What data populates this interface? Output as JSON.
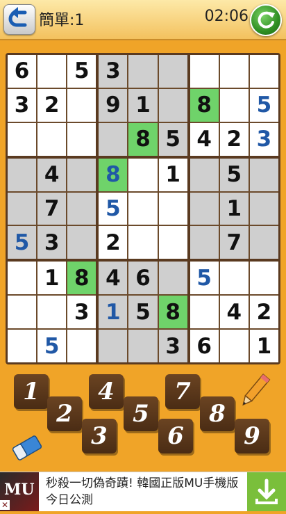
{
  "header": {
    "level_label": "簡單:1",
    "timer": "02:06",
    "back_icon": "back-arrow-icon",
    "confirm_icon": "refresh-check-icon"
  },
  "colors": {
    "background": "#f0a428",
    "cell_light": "#ffffff",
    "cell_dark": "#cfcfcf",
    "cell_highlight": "#6fd36a",
    "user_digit": "#2058a6",
    "key_brown": "#5a3a1a"
  },
  "grid": [
    [
      {
        "v": "6",
        "s": ""
      },
      {
        "v": "",
        "s": ""
      },
      {
        "v": "5",
        "s": ""
      },
      {
        "v": "3",
        "s": ""
      },
      {
        "v": "",
        "s": ""
      },
      {
        "v": "",
        "s": ""
      },
      {
        "v": "",
        "s": ""
      },
      {
        "v": "",
        "s": ""
      },
      {
        "v": "",
        "s": ""
      }
    ],
    [
      {
        "v": "3",
        "s": ""
      },
      {
        "v": "2",
        "s": ""
      },
      {
        "v": "",
        "s": ""
      },
      {
        "v": "9",
        "s": ""
      },
      {
        "v": "1",
        "s": ""
      },
      {
        "v": "",
        "s": ""
      },
      {
        "v": "8",
        "s": "green"
      },
      {
        "v": "",
        "s": ""
      },
      {
        "v": "5",
        "s": "blue"
      }
    ],
    [
      {
        "v": "",
        "s": ""
      },
      {
        "v": "",
        "s": ""
      },
      {
        "v": "",
        "s": ""
      },
      {
        "v": "",
        "s": ""
      },
      {
        "v": "8",
        "s": "green"
      },
      {
        "v": "5",
        "s": ""
      },
      {
        "v": "4",
        "s": ""
      },
      {
        "v": "2",
        "s": ""
      },
      {
        "v": "3",
        "s": "blue"
      }
    ],
    [
      {
        "v": "",
        "s": ""
      },
      {
        "v": "4",
        "s": ""
      },
      {
        "v": "",
        "s": ""
      },
      {
        "v": "8",
        "s": "green blue"
      },
      {
        "v": "",
        "s": ""
      },
      {
        "v": "1",
        "s": ""
      },
      {
        "v": "",
        "s": ""
      },
      {
        "v": "5",
        "s": ""
      },
      {
        "v": "",
        "s": ""
      }
    ],
    [
      {
        "v": "",
        "s": ""
      },
      {
        "v": "7",
        "s": ""
      },
      {
        "v": "",
        "s": ""
      },
      {
        "v": "5",
        "s": "blue"
      },
      {
        "v": "",
        "s": ""
      },
      {
        "v": "",
        "s": ""
      },
      {
        "v": "",
        "s": ""
      },
      {
        "v": "1",
        "s": ""
      },
      {
        "v": "",
        "s": ""
      }
    ],
    [
      {
        "v": "5",
        "s": "blue"
      },
      {
        "v": "3",
        "s": ""
      },
      {
        "v": "",
        "s": ""
      },
      {
        "v": "2",
        "s": ""
      },
      {
        "v": "",
        "s": ""
      },
      {
        "v": "",
        "s": ""
      },
      {
        "v": "",
        "s": ""
      },
      {
        "v": "7",
        "s": ""
      },
      {
        "v": "",
        "s": ""
      }
    ],
    [
      {
        "v": "",
        "s": ""
      },
      {
        "v": "1",
        "s": ""
      },
      {
        "v": "8",
        "s": "green"
      },
      {
        "v": "4",
        "s": ""
      },
      {
        "v": "6",
        "s": ""
      },
      {
        "v": "",
        "s": ""
      },
      {
        "v": "5",
        "s": "blue"
      },
      {
        "v": "",
        "s": ""
      },
      {
        "v": "",
        "s": ""
      }
    ],
    [
      {
        "v": "",
        "s": ""
      },
      {
        "v": "",
        "s": ""
      },
      {
        "v": "3",
        "s": ""
      },
      {
        "v": "1",
        "s": "blue"
      },
      {
        "v": "5",
        "s": ""
      },
      {
        "v": "8",
        "s": "green"
      },
      {
        "v": "",
        "s": ""
      },
      {
        "v": "4",
        "s": ""
      },
      {
        "v": "2",
        "s": ""
      }
    ],
    [
      {
        "v": "",
        "s": ""
      },
      {
        "v": "5",
        "s": "blue"
      },
      {
        "v": "",
        "s": ""
      },
      {
        "v": "",
        "s": ""
      },
      {
        "v": "",
        "s": ""
      },
      {
        "v": "3",
        "s": ""
      },
      {
        "v": "6",
        "s": ""
      },
      {
        "v": "",
        "s": ""
      },
      {
        "v": "1",
        "s": ""
      }
    ]
  ],
  "box_shading": [
    "light",
    "dark",
    "light",
    "dark",
    "light",
    "dark",
    "light",
    "dark",
    "light"
  ],
  "keypad": [
    "1",
    "2",
    "3",
    "4",
    "5",
    "6",
    "7",
    "8",
    "9"
  ],
  "tools": {
    "eraser_icon": "eraser-icon",
    "pencil_icon": "pencil-icon"
  },
  "ad": {
    "logo": "MU",
    "close": "✕",
    "text": "秒殺一切偽奇蹟! 韓國正版MU手機版今日公測",
    "download_icon": "download-icon"
  }
}
